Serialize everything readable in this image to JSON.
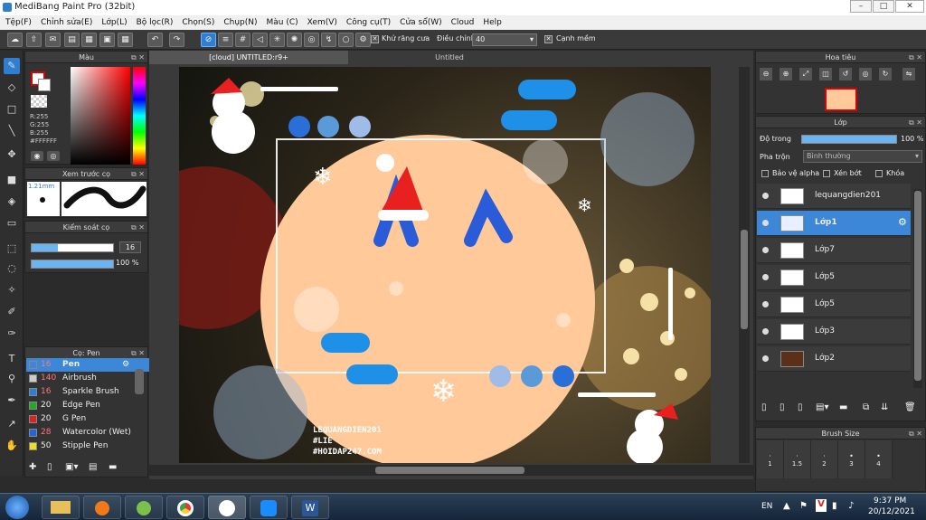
{
  "window": {
    "title": "MediBang Paint Pro (32bit)"
  },
  "menu": [
    "Tệp(F)",
    "Chỉnh sửa(E)",
    "Lớp(L)",
    "Bộ lọc(R)",
    "Chọn(S)",
    "Chụp(N)",
    "Màu (C)",
    "Xem(V)",
    "Công cụ(T)",
    "Cửa sổ(W)",
    "Cloud",
    "Help"
  ],
  "toolbar": {
    "antialias_label": "Khử răng cưa",
    "adjust_label": "Điều chỉnh",
    "adjust_value": "40",
    "snap_label": "Cạnh mềm"
  },
  "color_panel": {
    "title": "Màu",
    "r": "R:255",
    "g": "G:255",
    "b": "B:255",
    "hex": "#FFFFFF"
  },
  "brush_preview": {
    "title": "Xem trước cọ",
    "size": "1.21mm"
  },
  "brush_control": {
    "title": "Kiểm soát cọ",
    "size": "16",
    "opacity": "100 %"
  },
  "brush_list": {
    "title": "Cọ: Pen",
    "items": [
      {
        "size": "16",
        "name": "Pen",
        "color": "#3d87d8"
      },
      {
        "size": "140",
        "name": "Airbrush",
        "color": "#cccccc"
      },
      {
        "size": "16",
        "name": "Sparkle Brush",
        "color": "#2a7fd4"
      },
      {
        "size": "20",
        "name": "Edge Pen",
        "color": "#22aa22"
      },
      {
        "size": "20",
        "name": "G Pen",
        "color": "#dd2222"
      },
      {
        "size": "28",
        "name": "Watercolor (Wet)",
        "color": "#2266dd"
      },
      {
        "size": "50",
        "name": "Stipple Pen",
        "color": "#eedd22"
      }
    ]
  },
  "document_tabs": [
    "[cloud] UNTITLED:r9+",
    "Untitled"
  ],
  "artwork": {
    "line1": "LEQUANGDIEN201",
    "line2": "#LIE",
    "line3": "#HOIDAP247.COM",
    "bg_color": "#ffc99a"
  },
  "navigator": {
    "title": "Hoa tiêu"
  },
  "layer_panel": {
    "title": "Lớp",
    "opacity_label": "Độ trong",
    "opacity_value": "100 %",
    "blend_label": "Pha trộn",
    "blend_value": "Bình thường",
    "protect_alpha": "Bảo vệ alpha",
    "clip": "Xén bớt",
    "lock": "Khóa",
    "layers": [
      "lequangdien201",
      "Lớp1",
      "Lớp7",
      "Lớp5",
      "Lớp5",
      "Lớp3",
      "Lớp2"
    ]
  },
  "brush_size": {
    "title": "Brush Size",
    "sizes": [
      "1",
      "1.5",
      "2",
      "3",
      "4"
    ]
  },
  "taskbar": {
    "lang": "EN",
    "time": "9:37 PM",
    "date": "20/12/2021"
  }
}
